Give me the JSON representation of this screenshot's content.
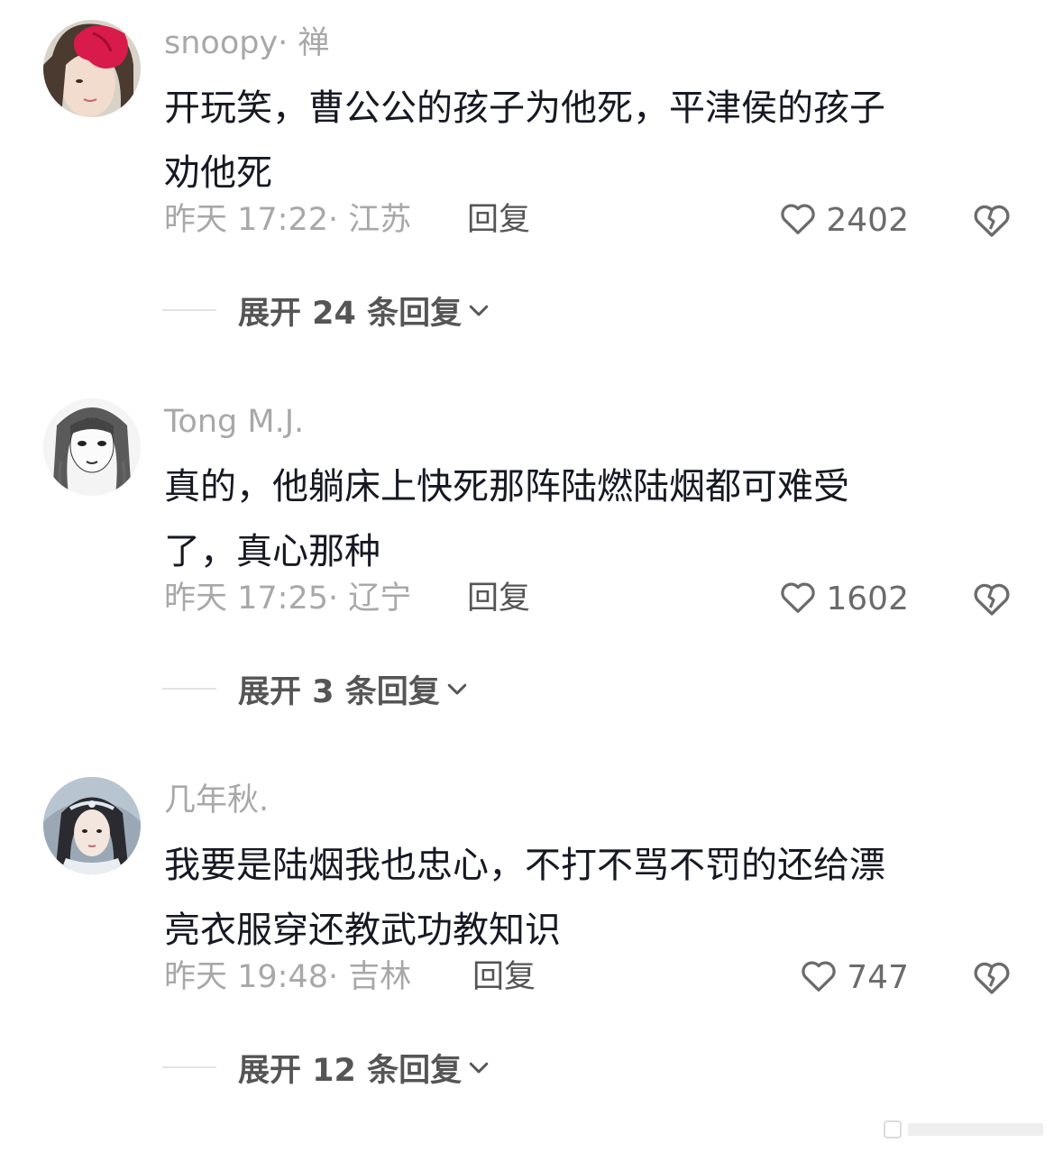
{
  "comments": [
    {
      "author": "snoopy· 禅",
      "text_line1": "开玩笑，曹公公的孩子为他死，平津侯的孩子",
      "text_line2": "劝他死",
      "time": "昨天 17:22· 江苏",
      "reply_label": "回复",
      "likes": "2402",
      "expand_label": "展开 24 条回复"
    },
    {
      "author": "Tong M.J.",
      "text_line1": "真的，他躺床上快死那阵陆燃陆烟都可难受",
      "text_line2": "了，真心那种",
      "time": "昨天 17:25· 辽宁",
      "reply_label": "回复",
      "likes": "1602",
      "expand_label": "展开 3 条回复"
    },
    {
      "author": "几年秋.",
      "text_line1": "我要是陆烟我也忠心，不打不骂不罚的还给漂",
      "text_line2": "亮衣服穿还教武功教知识",
      "time": "昨天 19:48· 吉林",
      "reply_label": "回复",
      "likes": "747",
      "expand_label": "展开 12 条回复"
    }
  ],
  "icons": {
    "like": "heart-outline-icon",
    "dislike": "broken-heart-icon",
    "expand": "chevron-down-icon"
  },
  "colors": {
    "author": "#a8a8a8",
    "text": "#161823",
    "meta": "#a8a8a8",
    "action": "#555555"
  }
}
